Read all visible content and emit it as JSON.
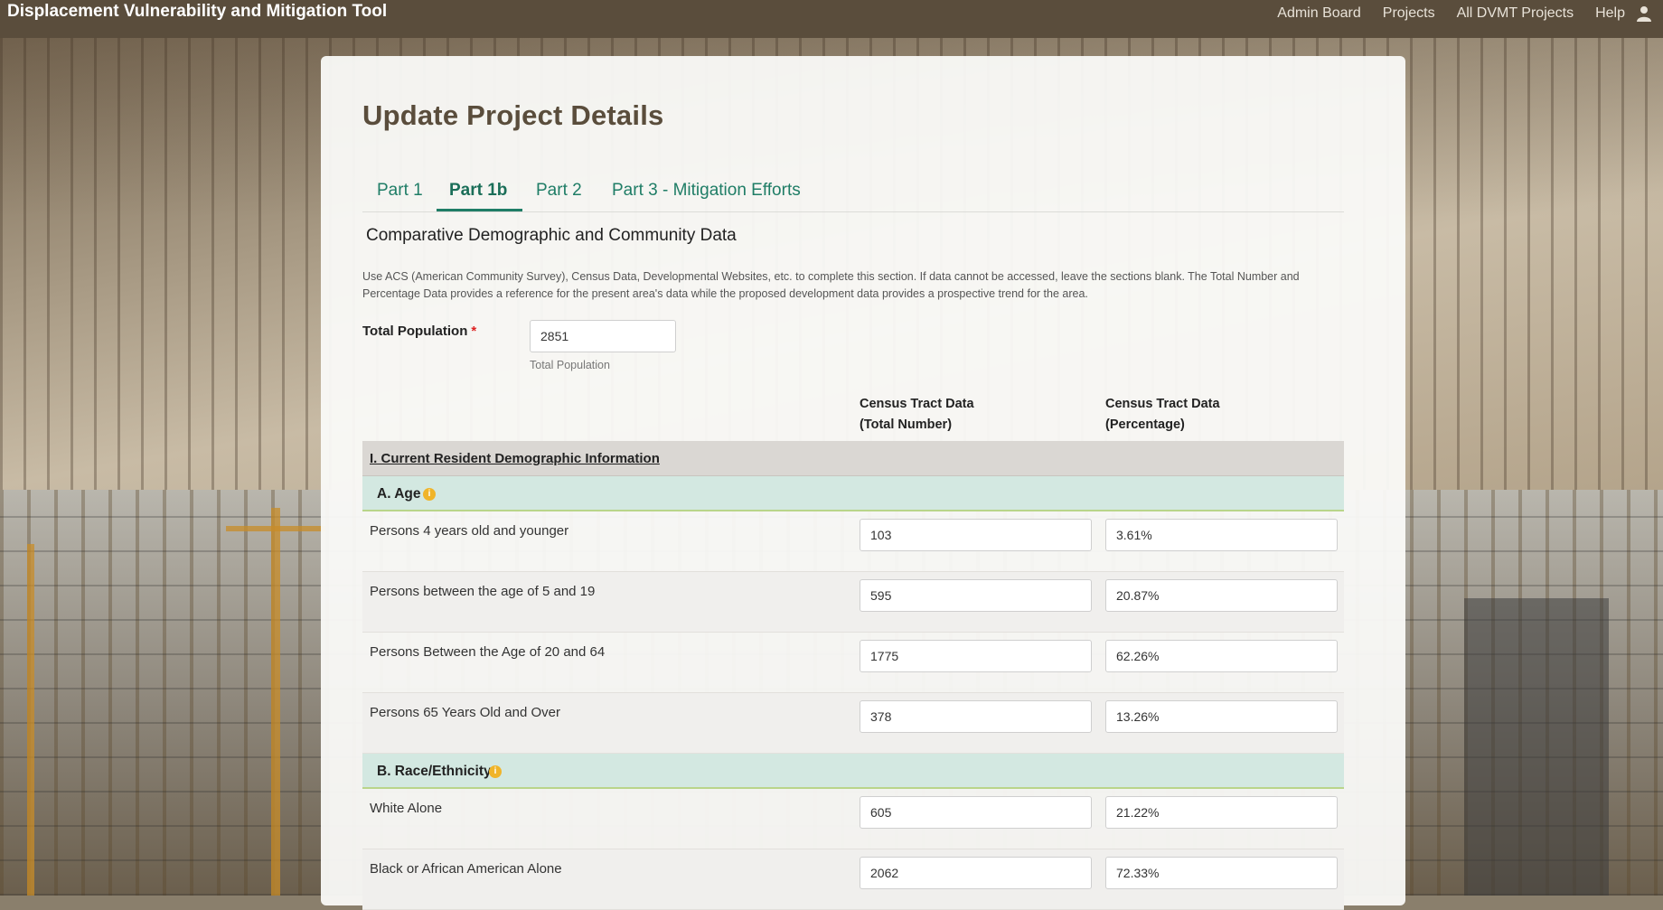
{
  "app": {
    "title": "Displacement Vulnerability and Mitigation Tool",
    "nav": [
      "Admin Board",
      "Projects",
      "All DVMT Projects",
      "Help"
    ]
  },
  "page": {
    "title": "Update Project Details",
    "tabs": [
      {
        "label": "Part 1",
        "active": false
      },
      {
        "label": "Part 1b",
        "active": true
      },
      {
        "label": "Part 2",
        "active": false
      },
      {
        "label": "Part 3 - Mitigation Efforts",
        "active": false
      }
    ],
    "section_title": "Comparative Demographic and Community Data",
    "intro": "Use ACS (American Community Survey), Census Data, Developmental Websites, etc. to complete this section. If data cannot be accessed, leave the sections blank. The Total Number and Percentage Data provides a reference for the present area's data while the proposed development data provides a prospective trend for the area."
  },
  "population": {
    "label": "Total Population",
    "required_mark": "*",
    "value": "2851",
    "help": "Total Population"
  },
  "columns": {
    "col1_line1": "Census Tract Data",
    "col1_line2": "(Total Number)",
    "col2_line1": "Census Tract Data",
    "col2_line2": "(Percentage)"
  },
  "table": {
    "header": "I. Current Resident Demographic Information",
    "age": {
      "title": "A. Age",
      "rows": [
        {
          "label": "Persons 4 years old and younger",
          "number": "103",
          "percent": "3.61%"
        },
        {
          "label": "Persons between the age of 5 and 19",
          "number": "595",
          "percent": "20.87%"
        },
        {
          "label": "Persons Between the Age of 20 and 64",
          "number": "1775",
          "percent": "62.26%"
        },
        {
          "label": "Persons 65 Years Old and Over",
          "number": "378",
          "percent": "13.26%"
        }
      ]
    },
    "race": {
      "title": "B. Race/Ethnicity",
      "rows": [
        {
          "label": "White Alone",
          "number": "605",
          "percent": "21.22%"
        },
        {
          "label": "Black or African American Alone",
          "number": "2062",
          "percent": "72.33%"
        }
      ]
    }
  },
  "colors": {
    "topbar": "#5a4d3c",
    "accent": "#1f7d66",
    "subheader": "#d3e8e1",
    "info_icon": "#f0b429"
  }
}
